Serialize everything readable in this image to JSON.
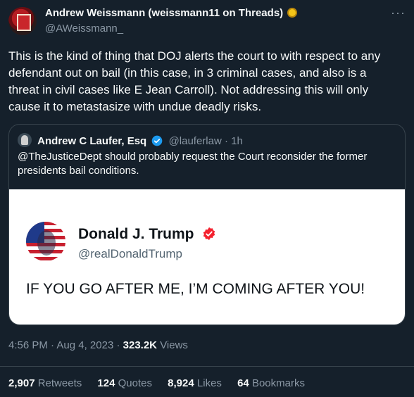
{
  "author": {
    "name": "Andrew Weissmann (weissmann11 on Threads)",
    "handle": "@AWeissmann_",
    "badge_icon": "sunflower-icon"
  },
  "tweet": {
    "text": "This is the kind of thing that DOJ alerts the court to with respect to any\ndefendant out on bail (in this case, in 3 criminal cases, and also is a\nthreat in civil cases like E Jean Carroll). Not addressing this will only\ncause it to metastasize with undue deadly risks."
  },
  "quote": {
    "name": "Andrew C Laufer, Esq",
    "handle": "@lauferlaw",
    "time": "1h",
    "text": "@TheJusticeDept should probably request the Court reconsider the former presidents bail conditions.",
    "image": {
      "name": "Donald J. Trump",
      "handle": "@realDonaldTrump",
      "text": "IF YOU GO AFTER ME, I’M COMING AFTER YOU!"
    }
  },
  "meta": {
    "time": "4:56 PM",
    "date": "Aug 4, 2023",
    "views_count": "323.2K",
    "views_label": "Views"
  },
  "stats": {
    "retweets_count": "2,907",
    "retweets_label": "Retweets",
    "quotes_count": "124",
    "quotes_label": "Quotes",
    "likes_count": "8,924",
    "likes_label": "Likes",
    "bookmarks_count": "64",
    "bookmarks_label": "Bookmarks"
  },
  "colors": {
    "background": "#15202b",
    "text": "#f7f9f9",
    "muted": "#8b98a5",
    "verified": "#1d9bf0",
    "trump_verified": "#f4212e"
  }
}
